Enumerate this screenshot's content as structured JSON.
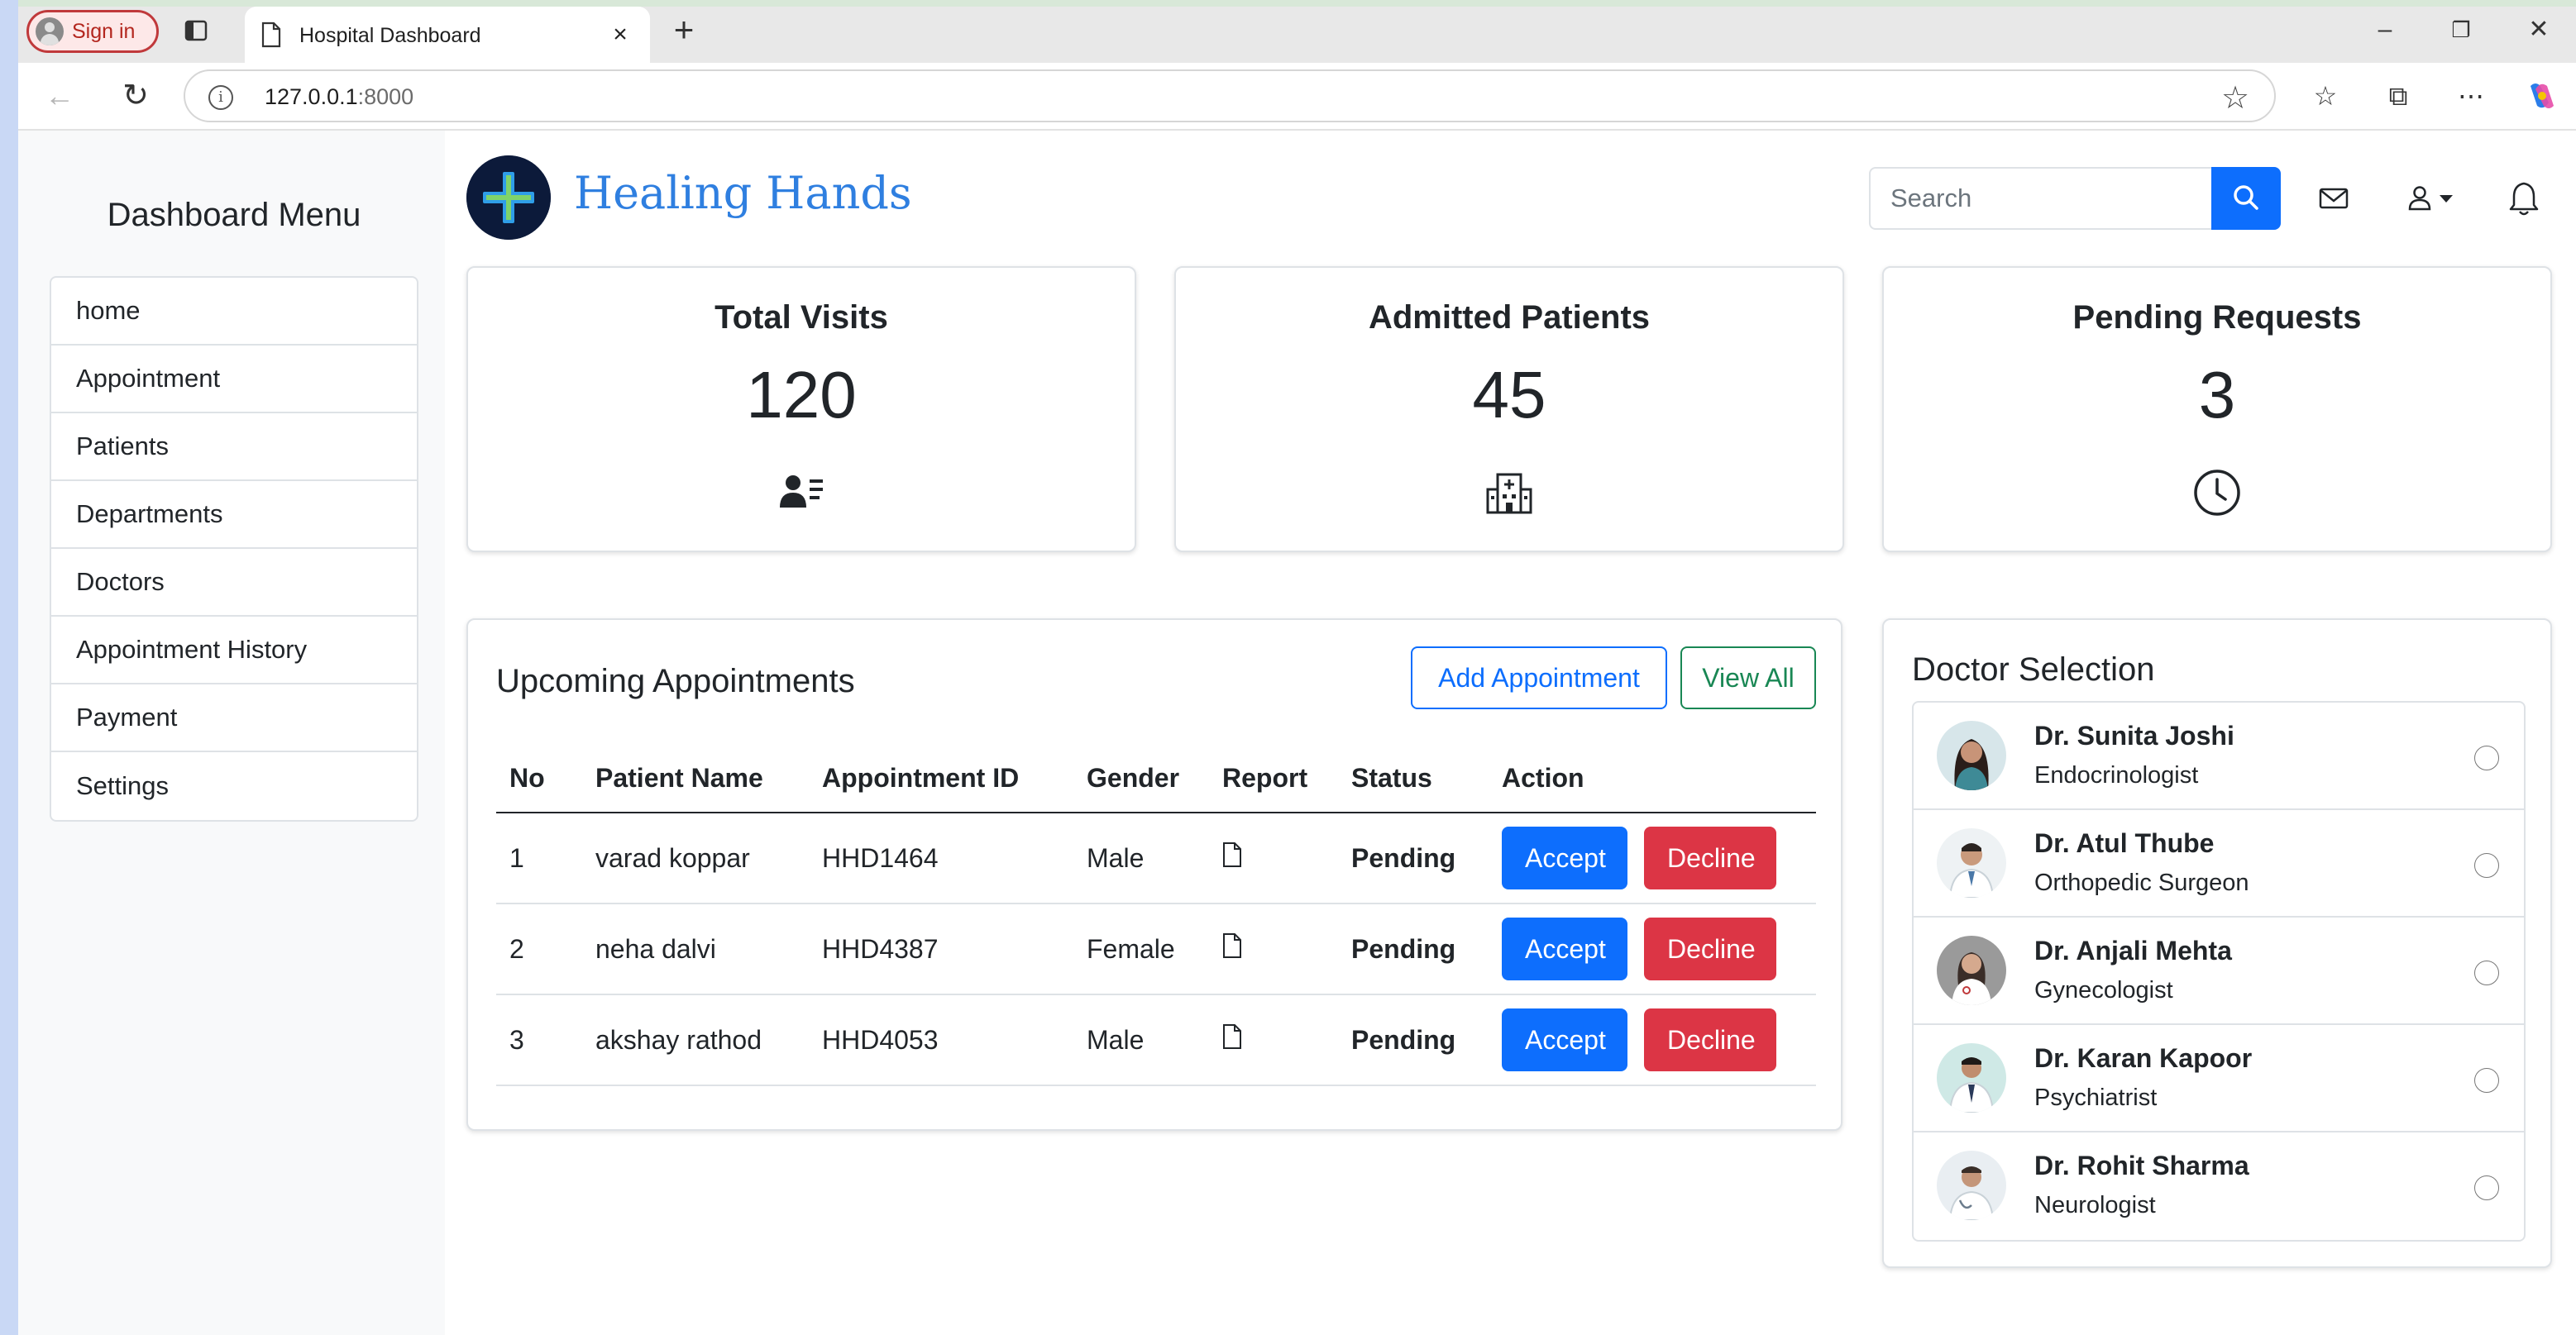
{
  "browser": {
    "signin_label": "Sign in",
    "tab_title": "Hospital Dashboard",
    "url_host": "127.0.0.1",
    "url_port": ":8000"
  },
  "sidebar": {
    "title": "Dashboard Menu",
    "items": [
      {
        "label": "home"
      },
      {
        "label": "Appointment"
      },
      {
        "label": "Patients"
      },
      {
        "label": "Departments"
      },
      {
        "label": "Doctors"
      },
      {
        "label": "Appointment History"
      },
      {
        "label": "Payment"
      },
      {
        "label": "Settings"
      }
    ]
  },
  "header": {
    "brand": "Healing Hands",
    "search_placeholder": "Search"
  },
  "stats": [
    {
      "title": "Total Visits",
      "value": "120",
      "icon": "patient-list-icon"
    },
    {
      "title": "Admitted Patients",
      "value": "45",
      "icon": "hospital-icon"
    },
    {
      "title": "Pending Requests",
      "value": "3",
      "icon": "clock-icon"
    }
  ],
  "appointments": {
    "title": "Upcoming Appointments",
    "add_button": "Add Appointment",
    "view_all_button": "View All",
    "columns": [
      "No",
      "Patient Name",
      "Appointment ID",
      "Gender",
      "Report",
      "Status",
      "Action"
    ],
    "rows": [
      {
        "no": "1",
        "name": "varad koppar",
        "id": "HHD1464",
        "gender": "Male",
        "status": "Pending",
        "accept": "Accept",
        "decline": "Decline"
      },
      {
        "no": "2",
        "name": "neha dalvi",
        "id": "HHD4387",
        "gender": "Female",
        "status": "Pending",
        "accept": "Accept",
        "decline": "Decline"
      },
      {
        "no": "3",
        "name": "akshay rathod",
        "id": "HHD4053",
        "gender": "Male",
        "status": "Pending",
        "accept": "Accept",
        "decline": "Decline"
      }
    ]
  },
  "doctors": {
    "title": "Doctor Selection",
    "items": [
      {
        "name": "Dr. Sunita Joshi",
        "specialty": "Endocrinologist"
      },
      {
        "name": "Dr. Atul Thube",
        "specialty": "Orthopedic Surgeon"
      },
      {
        "name": "Dr. Anjali Mehta",
        "specialty": "Gynecologist"
      },
      {
        "name": "Dr. Karan Kapoor",
        "specialty": "Psychiatrist"
      },
      {
        "name": "Dr. Rohit Sharma",
        "specialty": "Neurologist"
      }
    ]
  },
  "colors": {
    "primary": "#0d6efd",
    "danger": "#dc3545",
    "success": "#198754",
    "brand": "#2f7fe0",
    "logo_bg": "#0c1a3a"
  }
}
